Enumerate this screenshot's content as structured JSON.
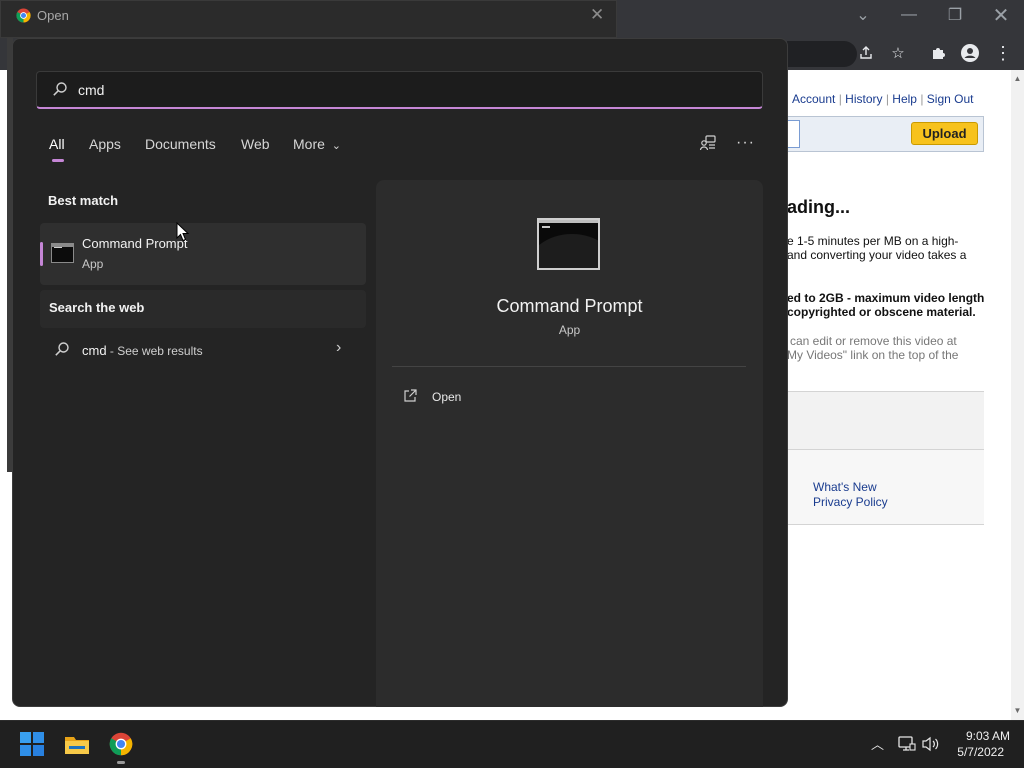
{
  "dialog": {
    "title": "Open"
  },
  "website": {
    "nav": [
      "Account",
      "History",
      "Help",
      "Sign Out"
    ],
    "upload_label": "Upload",
    "heading": "ading...",
    "body_lines": [
      "e 1-5 minutes per MB on a high-",
      "and converting your video takes a"
    ],
    "bold_lines": [
      "ed to 2GB - maximum video length",
      "copyrighted or obscene material."
    ],
    "gray_lines": [
      "can edit or remove this video at",
      "My Videos\" link on the top of the"
    ],
    "footer_links": [
      "What's New",
      "Privacy Policy"
    ]
  },
  "start_menu": {
    "search": {
      "value": "cmd"
    },
    "tabs": [
      "All",
      "Apps",
      "Documents",
      "Web",
      "More"
    ],
    "best_match_label": "Best match",
    "best_match": {
      "name": "Command Prompt",
      "type": "App"
    },
    "search_web_label": "Search the web",
    "web_result": {
      "query": "cmd",
      "suffix": " - See web results"
    },
    "detail": {
      "name": "Command Prompt",
      "type": "App",
      "action_open": "Open"
    }
  },
  "taskbar": {
    "time": "9:03 AM",
    "date": "5/7/2022"
  },
  "colors": {
    "accent": "#c586d6",
    "menu_bg": "#242424",
    "pane_bg": "#2c2c2c",
    "upload_bg": "#f7c21c",
    "link": "#1a3c8f"
  },
  "icons": [
    "chrome-icon",
    "close-icon",
    "chevron-down-icon",
    "minimize-icon",
    "restore-icon",
    "share-icon",
    "star-icon",
    "puzzle-icon",
    "profile-icon",
    "kebab-icon",
    "search-icon",
    "share-screen-icon",
    "ellipsis-icon",
    "terminal-icon",
    "open-external-icon",
    "chevron-right-icon",
    "windows-icon",
    "file-explorer-icon",
    "caret-up-icon",
    "network-icon",
    "volume-icon"
  ]
}
